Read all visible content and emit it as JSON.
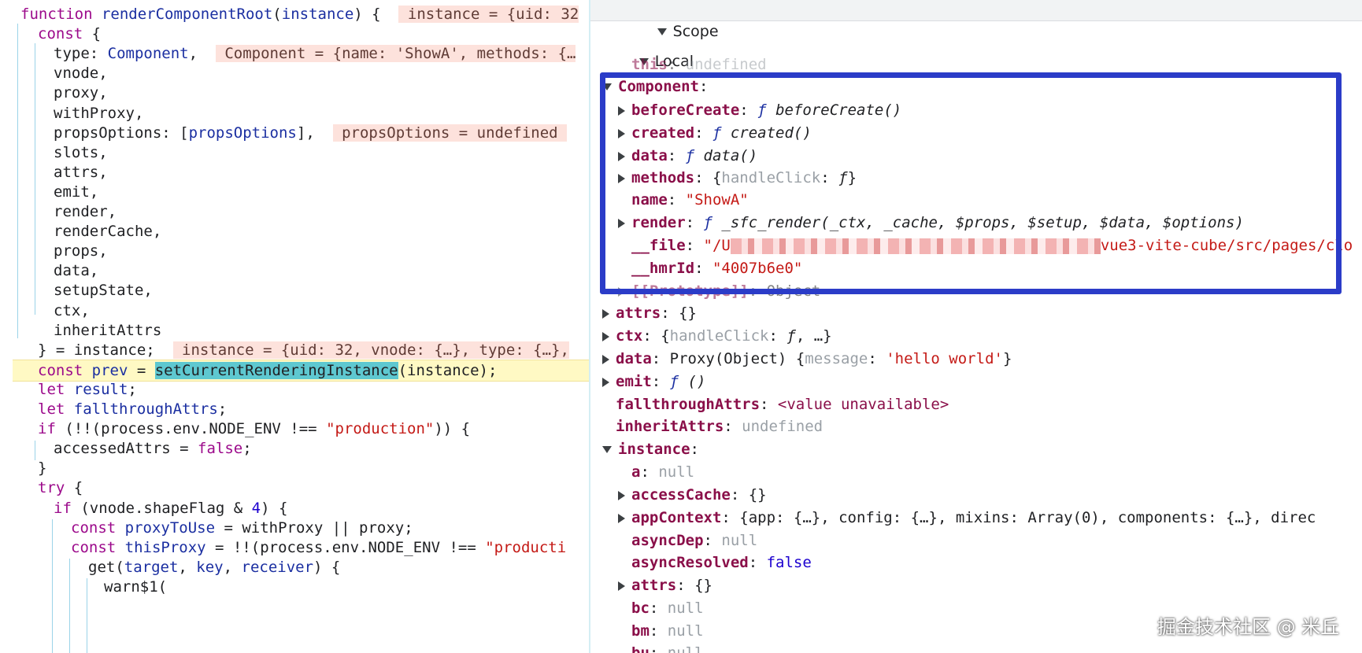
{
  "code_lines": [
    {
      "t": [
        [
          "function ",
          "kw"
        ],
        [
          "renderComponentRoot",
          "fn"
        ],
        [
          "(",
          ""
        ],
        [
          "instance",
          "vr"
        ],
        [
          ") {  ",
          ""
        ],
        [
          " instance = {uid: 32",
          "inl"
        ]
      ]
    },
    {
      "t": [
        [
          "const ",
          "kw"
        ],
        [
          "{",
          ""
        ]
      ]
    },
    {
      "t": [
        [
          "type: ",
          ""
        ],
        [
          "Component",
          "vr"
        ],
        [
          ",  ",
          ""
        ],
        [
          " Component = {name: 'ShowA', methods: {…",
          "inl"
        ]
      ]
    },
    {
      "t": [
        [
          "vnode,",
          ""
        ]
      ]
    },
    {
      "t": [
        [
          "proxy,",
          ""
        ]
      ]
    },
    {
      "t": [
        [
          "withProxy,",
          ""
        ]
      ]
    },
    {
      "t": [
        [
          "propsOptions: [",
          ""
        ],
        [
          "propsOptions",
          "vr"
        ],
        [
          "],  ",
          ""
        ],
        [
          " propsOptions = undefined ",
          "inl"
        ]
      ]
    },
    {
      "t": [
        [
          "slots,",
          ""
        ]
      ]
    },
    {
      "t": [
        [
          "attrs,",
          ""
        ]
      ]
    },
    {
      "t": [
        [
          "emit,",
          ""
        ]
      ]
    },
    {
      "t": [
        [
          "render,",
          ""
        ]
      ]
    },
    {
      "t": [
        [
          "renderCache,",
          ""
        ]
      ]
    },
    {
      "t": [
        [
          "props,",
          ""
        ]
      ]
    },
    {
      "t": [
        [
          "data,",
          ""
        ]
      ]
    },
    {
      "t": [
        [
          "setupState,",
          ""
        ]
      ]
    },
    {
      "t": [
        [
          "ctx,",
          ""
        ]
      ]
    },
    {
      "t": [
        [
          "inheritAttrs",
          ""
        ]
      ]
    },
    {
      "t": [
        [
          "} = instance;  ",
          ""
        ],
        [
          " instance = {uid: 32, vnode: {…}, type: {…},",
          "inl"
        ]
      ]
    },
    {
      "t": [
        [
          "const ",
          "kw"
        ],
        [
          "prev",
          "vr"
        ],
        [
          " = ",
          ""
        ],
        [
          "setCurrentRenderingInstance",
          "hlword"
        ],
        [
          "(instance);",
          ""
        ]
      ]
    },
    {
      "t": [
        [
          "let ",
          "kw"
        ],
        [
          "result",
          "vr"
        ],
        [
          ";",
          ""
        ]
      ]
    },
    {
      "t": [
        [
          "let ",
          "kw"
        ],
        [
          "fallthroughAttrs",
          "vr"
        ],
        [
          ";",
          ""
        ]
      ]
    },
    {
      "t": [
        [
          "if ",
          "kw"
        ],
        [
          "(!!(process.env.NODE_ENV !== ",
          ""
        ],
        [
          "\"production\"",
          "str"
        ],
        [
          ")) {",
          ""
        ]
      ]
    },
    {
      "t": [
        [
          "accessedAttrs = ",
          ""
        ],
        [
          "false",
          "kw"
        ],
        [
          ";",
          ""
        ]
      ]
    },
    {
      "t": [
        [
          "}",
          ""
        ]
      ]
    },
    {
      "t": [
        [
          "try ",
          "kw"
        ],
        [
          "{",
          ""
        ]
      ]
    },
    {
      "t": [
        [
          "if ",
          "kw"
        ],
        [
          "(vnode.shapeFlag & ",
          ""
        ],
        [
          "4",
          "num"
        ],
        [
          ") {",
          ""
        ]
      ]
    },
    {
      "t": [
        [
          "const ",
          "kw"
        ],
        [
          "proxyToUse",
          "vr"
        ],
        [
          " = withProxy || proxy;",
          ""
        ]
      ]
    },
    {
      "t": [
        [
          "const ",
          "kw"
        ],
        [
          "thisProxy",
          "vr"
        ],
        [
          " = !!(process.env.NODE_ENV !== ",
          ""
        ],
        [
          "\"producti",
          "str"
        ]
      ]
    },
    {
      "t": [
        [
          "get(",
          ""
        ],
        [
          "target",
          "vr"
        ],
        [
          ", ",
          ""
        ],
        [
          "key",
          "vr"
        ],
        [
          ", ",
          ""
        ],
        [
          "receiver",
          "vr"
        ],
        [
          ") {",
          ""
        ]
      ]
    },
    {
      "t": [
        [
          "warn$1(",
          ""
        ]
      ]
    }
  ],
  "scope": {
    "header": "Scope",
    "local_label": "Local",
    "rows": [
      {
        "k": "this",
        "sep": ": ",
        "v": [
          [
            "undefined",
            "gray"
          ]
        ],
        "dim": true
      },
      {
        "k": "Component",
        "sep": ":",
        "v": []
      },
      {
        "k": "beforeCreate",
        "sep": ": ",
        "v": [
          [
            "ƒ ",
            "fsym"
          ],
          [
            "beforeCreate()",
            "it"
          ]
        ]
      },
      {
        "k": "created",
        "sep": ": ",
        "v": [
          [
            "ƒ ",
            "fsym"
          ],
          [
            "created()",
            "it"
          ]
        ]
      },
      {
        "k": "data",
        "sep": ": ",
        "v": [
          [
            "ƒ ",
            "fsym"
          ],
          [
            "data()",
            "it"
          ]
        ]
      },
      {
        "k": "methods",
        "sep": ": ",
        "v": [
          [
            "{",
            ""
          ],
          [
            "handleClick",
            "gray"
          ],
          [
            ": ",
            ""
          ],
          [
            "ƒ",
            "it"
          ],
          [
            "}",
            ""
          ]
        ]
      },
      {
        "k": "name",
        "sep": ": ",
        "v": [
          [
            "\"ShowA\"",
            "sv"
          ]
        ]
      },
      {
        "k": "render",
        "sep": ": ",
        "v": [
          [
            "ƒ ",
            "fsym"
          ],
          [
            "_sfc_render(_ctx, _cache, $props, $setup, $data, $options)",
            "it"
          ]
        ]
      },
      {
        "k": "__file",
        "sep": ": ",
        "v": [
          [
            "\"/U",
            "sv"
          ],
          [
            "BLUR",
            ""
          ],
          [
            "vue3-vite-cube/src/pages/clo",
            "sv"
          ]
        ]
      },
      {
        "k": "__hmrId",
        "sep": ": ",
        "v": [
          [
            "\"4007b6e0\"",
            "sv"
          ]
        ]
      },
      {
        "k": "[[Prototype]]",
        "sep": ": ",
        "v": [
          [
            "Object",
            ""
          ]
        ],
        "dim": true
      },
      {
        "k": "attrs",
        "sep": ": ",
        "v": [
          [
            "{}",
            ""
          ]
        ]
      },
      {
        "k": "ctx",
        "sep": ": ",
        "v": [
          [
            "{",
            ""
          ],
          [
            "handleClick",
            "gray"
          ],
          [
            ": ",
            ""
          ],
          [
            "ƒ",
            "it"
          ],
          [
            ", …}",
            ""
          ]
        ]
      },
      {
        "k": "data",
        "sep": ": ",
        "v": [
          [
            "Proxy(Object) ",
            ""
          ],
          [
            "{",
            ""
          ],
          [
            "message",
            "gray"
          ],
          [
            ": ",
            ""
          ],
          [
            "'hello world'",
            "sv"
          ],
          [
            "}",
            ""
          ]
        ]
      },
      {
        "k": "emit",
        "sep": ": ",
        "v": [
          [
            "ƒ ",
            "fsym"
          ],
          [
            "()",
            "it"
          ]
        ]
      },
      {
        "k": "fallthroughAttrs",
        "sep": ": ",
        "v": [
          [
            "<value unavailable>",
            "pk-plain"
          ]
        ]
      },
      {
        "k": "inheritAttrs",
        "sep": ": ",
        "v": [
          [
            "undefined",
            "gray"
          ]
        ]
      },
      {
        "k": "instance",
        "sep": ":",
        "v": []
      },
      {
        "k": "a",
        "sep": ": ",
        "v": [
          [
            "null",
            "gray"
          ]
        ]
      },
      {
        "k": "accessCache",
        "sep": ": ",
        "v": [
          [
            "{}",
            ""
          ]
        ]
      },
      {
        "k": "appContext",
        "sep": ": ",
        "v": [
          [
            "{app: {…}, config: {…}, mixins: Array(0), components: {…}, direc",
            ""
          ]
        ]
      },
      {
        "k": "asyncDep",
        "sep": ": ",
        "v": [
          [
            "null",
            "gray"
          ]
        ]
      },
      {
        "k": "asyncResolved",
        "sep": ": ",
        "v": [
          [
            "false",
            "nv"
          ]
        ]
      },
      {
        "k": "attrs",
        "sep": ": ",
        "v": [
          [
            "{}",
            ""
          ]
        ]
      },
      {
        "k": "bc",
        "sep": ": ",
        "v": [
          [
            "null",
            "gray"
          ]
        ]
      },
      {
        "k": "bm",
        "sep": ": ",
        "v": [
          [
            "null",
            "gray"
          ]
        ]
      },
      {
        "k": "bu",
        "sep": ": ",
        "v": [
          [
            "null",
            "gray"
          ]
        ]
      }
    ]
  },
  "watermark": "掘金技术社区 @ 米丘",
  "colors": {
    "highlight_box": "#2b3cc8",
    "paused_line": "#fff9c4",
    "property_key": "#8a0f49"
  }
}
